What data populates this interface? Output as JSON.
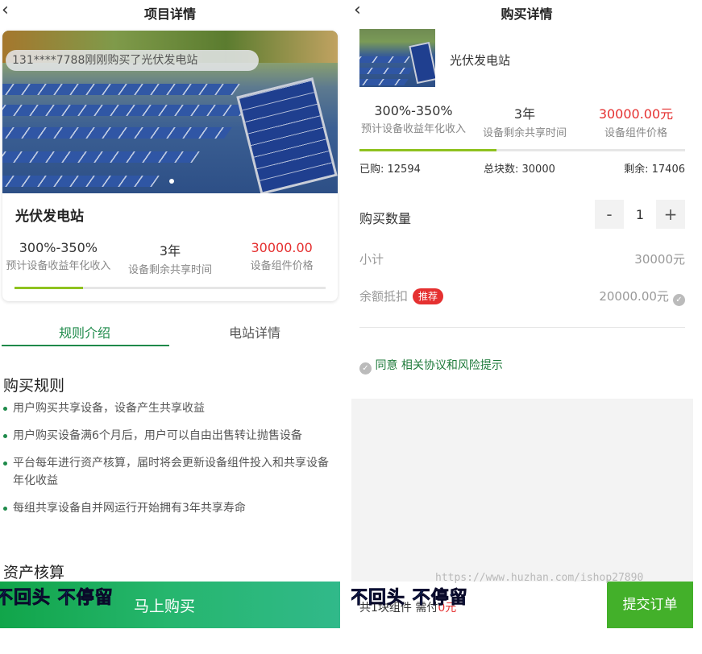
{
  "left": {
    "title": "项目详情",
    "back_icon": "chevron-left-icon",
    "notice": "131****7788刚刚购买了光伏发电站",
    "product_name": "光伏发电站",
    "stats": [
      {
        "value": "300%-350%",
        "label": "预计设备收益年化收入"
      },
      {
        "value": "3年",
        "label": "设备剩余共享时间"
      },
      {
        "value": "30000.00",
        "label": "设备组件价格"
      }
    ],
    "progress": 0.22,
    "tabs": [
      "规则介绍",
      "电站详情"
    ],
    "rules_title": "购买规则",
    "rules": [
      "用户购买共享设备，设备产生共享收益",
      "用户购买设备满6个月后，用户可以自由出售转让抛售设备",
      "平台每年进行资产核算，届时将会更新设备组件投入和共享设备年化收益",
      "每组共享设备自并网运行开始拥有3年共享寿命"
    ],
    "audit_title": "资产核算",
    "buy_button": "马上购买",
    "overlay_text": "不回头 不停留"
  },
  "right": {
    "title": "购买详情",
    "back_icon": "chevron-left-icon",
    "product_name": "光伏发电站",
    "stats": [
      {
        "value": "300%-350%",
        "label": "预计设备收益年化收入"
      },
      {
        "value": "3年",
        "label": "设备剩余共享时间"
      },
      {
        "value": "30000.00元",
        "label": "设备组件价格"
      }
    ],
    "progress": 0.42,
    "purchased": "已购: 12594",
    "total_blocks": "总块数: 30000",
    "remaining": "剩余: 17406",
    "qty_label": "购买数量",
    "qty_minus": "-",
    "qty_value": "1",
    "qty_plus": "+",
    "subtotal_label": "小计",
    "subtotal_value": "30000元",
    "balance_label": "余额抵扣",
    "balance_badge": "推荐",
    "balance_value": "20000.00元",
    "agree_text": "同意 相关协议和风险提示",
    "total_prefix": "共1块组件 需付",
    "total_amount": "0元",
    "submit_button": "提交订单",
    "overlay_text": "不回头 不停留",
    "watermark": "https://www.huzhan.com/ishop27890"
  },
  "colors": {
    "accent_green": "#1e8a4a",
    "price_red": "#e53030",
    "progress_green": "#8fc21f",
    "submit_green": "#43b02a"
  }
}
